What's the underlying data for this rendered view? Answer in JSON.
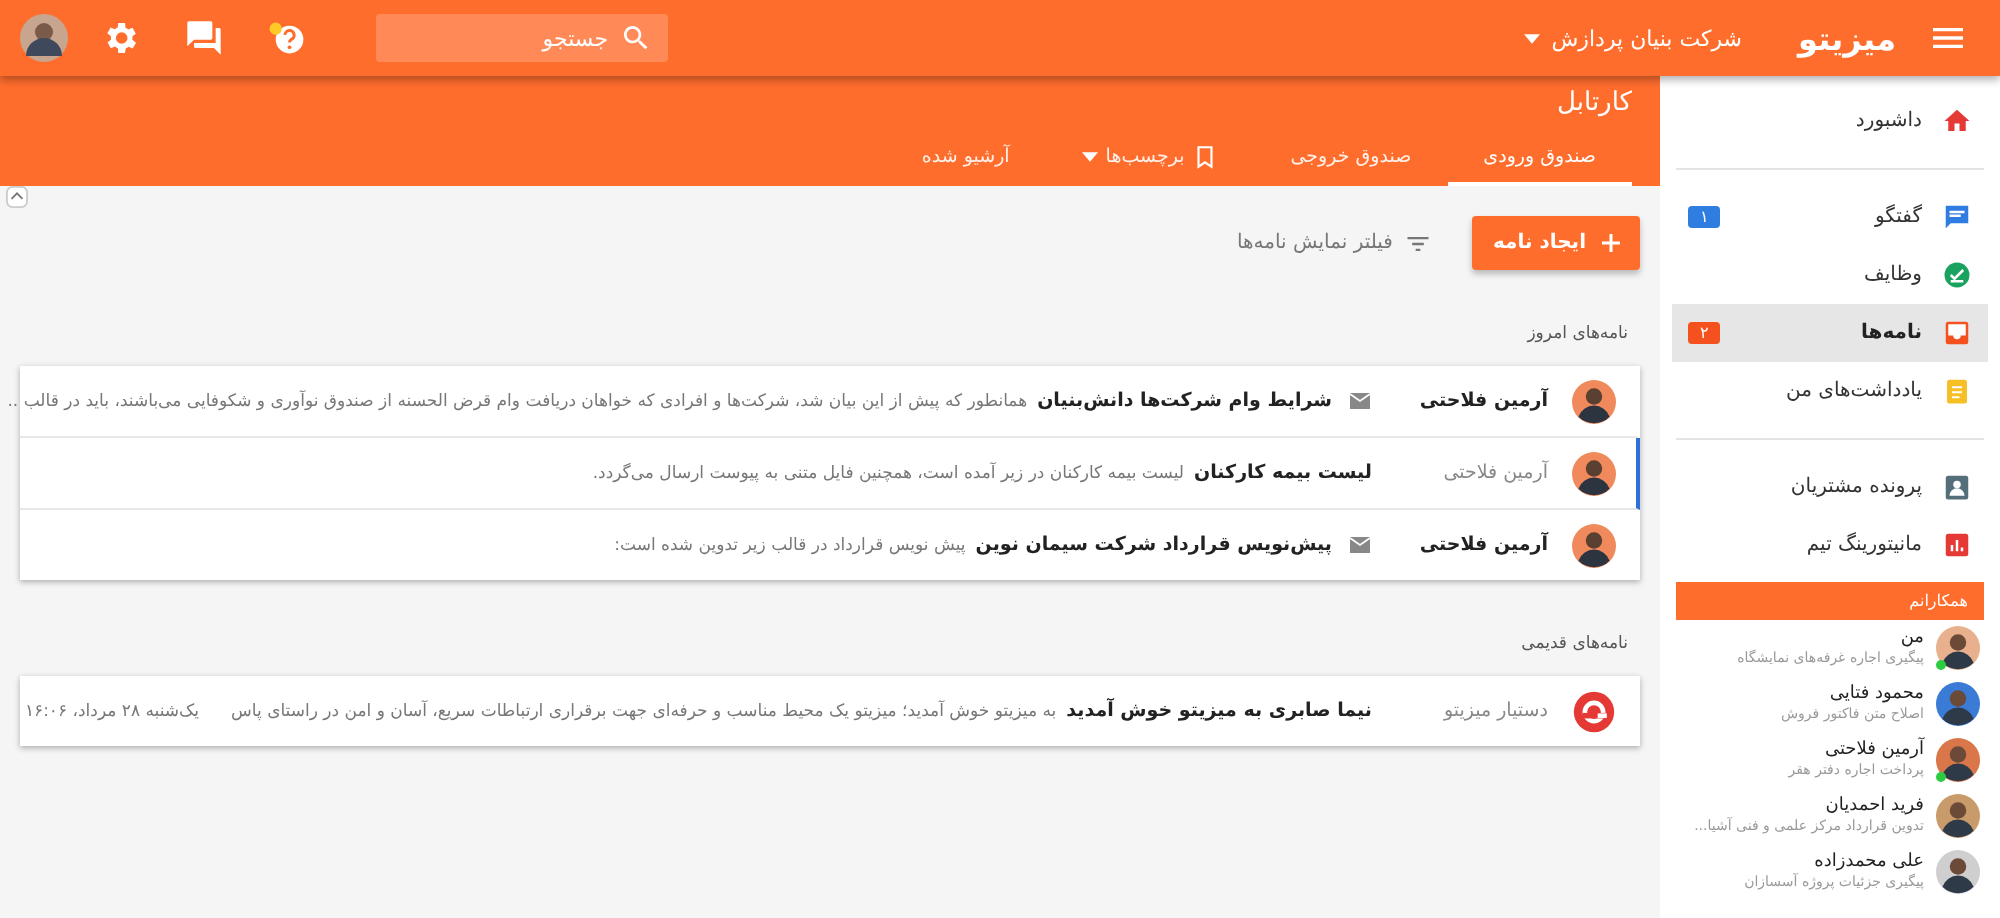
{
  "topbar": {
    "logo": "میزیتو",
    "company": "شرکت بنیان پردازش",
    "search": {
      "placeholder": "جستجو"
    },
    "help_notification": true
  },
  "header": {
    "title": "کارتابل",
    "tabs": [
      {
        "label": "صندوق ورودی",
        "selected": true,
        "kind": "plain"
      },
      {
        "label": "صندوق خروجی",
        "selected": false,
        "kind": "plain"
      },
      {
        "label": "برچسب‌ها",
        "selected": false,
        "kind": "labels"
      },
      {
        "label": "آرشیو شده",
        "selected": false,
        "kind": "plain"
      }
    ]
  },
  "toolbar": {
    "create_button": "ایجاد نامه",
    "filter": "فیلتر نمایش نامه‌ها"
  },
  "sections": [
    {
      "title": "نامه‌های امروز",
      "messages": [
        {
          "sender": "آرمین فلاحتی",
          "unread": true,
          "selected": false,
          "mail_icon": true,
          "subject": "شرایط وام شرکت‌ها دانش‌بنیان",
          "preview": "همانطور که پیش از این بیان شد، شرکت‌ها و افرادی که خواهان دریافت وام قرض الحسنه از صندوق نوآوری و شکوفایی می‌باشند، باید در قالب ..",
          "kind": "person"
        },
        {
          "sender": "آرمین فلاحتی",
          "unread": false,
          "selected": true,
          "mail_icon": false,
          "subject": "لیست بیمه کارکنان",
          "preview": "لیست بیمه کارکنان در زیر آمده است، همچنین فایل متنی به پیوست ارسال می‌گردد.",
          "kind": "person"
        },
        {
          "sender": "آرمین فلاحتی",
          "unread": true,
          "selected": false,
          "mail_icon": true,
          "subject": "پیش‌نویس قرارداد شرکت سیمان نوین",
          "preview": "پیش نویس قرارداد در قالب زیر تدوین شده است:",
          "kind": "person"
        }
      ]
    },
    {
      "title": "نامه‌های قدیمی",
      "messages": [
        {
          "sender": "دستیار میزیتو",
          "unread": false,
          "selected": false,
          "mail_icon": false,
          "subject": "نیما صابری به میزیتو خوش آمدید",
          "preview": "به میزیتو خوش آمدید؛ میزیتو یک محیط مناسب و حرفه‌ای جهت برقراری ارتباطات سریع، آسان و امن در راستای پاس",
          "date": "یک‌شنبه ۲۸ مرداد، ۱۶:۰۶",
          "kind": "bot"
        }
      ]
    }
  ],
  "sidebar": {
    "groups": [
      [
        {
          "label": "داشبورد",
          "kind": "home",
          "color": "#e53935",
          "selected": false
        }
      ],
      [
        {
          "label": "گفتگو",
          "kind": "chat",
          "color": "#2f7de1",
          "selected": false,
          "badge": "۱"
        },
        {
          "label": "وظایف",
          "kind": "check",
          "color": "#1aa260",
          "selected": false
        },
        {
          "label": "نامه‌ها",
          "kind": "inbox",
          "color": "#f4511e",
          "selected": true,
          "badge": "۲"
        },
        {
          "label": "یادداشت‌های من",
          "kind": "note",
          "color": "#f6bf26",
          "selected": false
        }
      ],
      [
        {
          "label": "پرونده مشتریان",
          "kind": "contact",
          "color": "#546e7a",
          "selected": false
        },
        {
          "label": "مانیتورینگ تیم",
          "kind": "chart",
          "color": "#e53935",
          "selected": false
        }
      ]
    ],
    "team_title": "همکارانم",
    "team": [
      {
        "name": "من",
        "task": "پیگیری اجاره غرفه‌های نمایشگاه",
        "online": true
      },
      {
        "name": "محمود فتایی",
        "task": "اصلاح متن فاکتور فروش",
        "online": false
      },
      {
        "name": "آرمین فلاحتی",
        "task": "پرداخت اجاره دفتر هقر",
        "online": true
      },
      {
        "name": "فرید احمدیان",
        "task": "تدوین قرارداد مرکز علمی و فنی آشیا...",
        "online": false
      },
      {
        "name": "علی محمدزاده",
        "task": "پیگیری جزئیات پروژه آسسازان",
        "online": false
      }
    ]
  }
}
